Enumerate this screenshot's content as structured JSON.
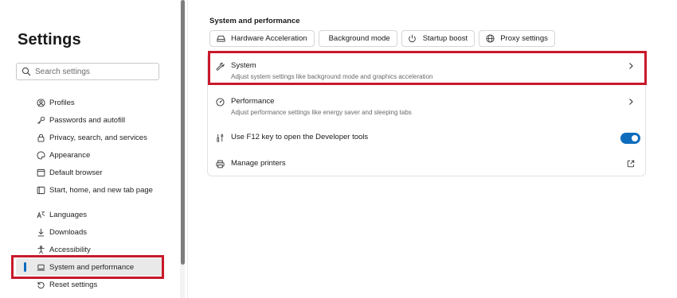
{
  "sidebar": {
    "title": "Settings",
    "search_placeholder": "Search settings",
    "group1": [
      {
        "label": "Profiles",
        "icon": "profile-icon"
      },
      {
        "label": "Passwords and autofill",
        "icon": "key-icon"
      },
      {
        "label": "Privacy, search, and services",
        "icon": "lock-icon"
      },
      {
        "label": "Appearance",
        "icon": "appearance-icon"
      },
      {
        "label": "Default browser",
        "icon": "browser-icon"
      },
      {
        "label": "Start, home, and new tab page",
        "icon": "home-page-icon"
      }
    ],
    "group2": [
      {
        "label": "Languages",
        "icon": "languages-icon"
      },
      {
        "label": "Downloads",
        "icon": "download-icon"
      },
      {
        "label": "Accessibility",
        "icon": "accessibility-icon"
      },
      {
        "label": "System and performance",
        "icon": "laptop-icon",
        "active": true
      },
      {
        "label": "Reset settings",
        "icon": "reset-icon"
      }
    ]
  },
  "main": {
    "section_title": "System and performance",
    "chips": [
      {
        "label": "Hardware Acceleration",
        "icon": "drive-icon"
      },
      {
        "label": "Background mode",
        "icon": ""
      },
      {
        "label": "Startup boost",
        "icon": "power-icon"
      },
      {
        "label": "Proxy settings",
        "icon": "globe-icon"
      }
    ],
    "rows": {
      "system": {
        "label": "System",
        "desc": "Adjust system settings like background mode and graphics acceleration"
      },
      "performance": {
        "label": "Performance",
        "desc": "Adjust performance settings like energy saver and sleeping tabs"
      },
      "f12": {
        "label": "Use F12 key to open the Developer tools",
        "toggle_on": true
      },
      "printers": {
        "label": "Manage printers"
      }
    }
  },
  "colors": {
    "accent": "#0f6cbd",
    "highlight": "#c8192b"
  }
}
